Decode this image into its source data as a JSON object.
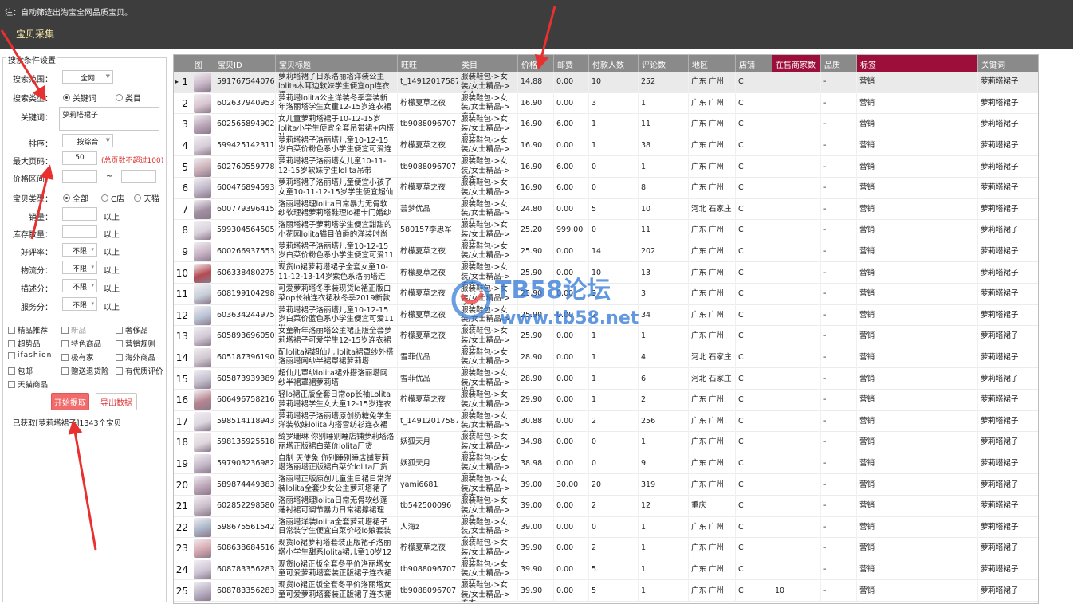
{
  "header": {
    "note": "注：自动筛选出淘宝全网品质宝贝。",
    "title": "宝贝采集"
  },
  "search": {
    "legend": "搜索条件设置",
    "range_label": "搜索范围：",
    "range_value": "全网",
    "type_label": "搜索类型：",
    "type_keyword": "关键词",
    "type_category": "类目",
    "keyword_label": "关键词：",
    "keyword_value": "萝莉塔裙子",
    "sort_label": "排序：",
    "sort_value": "按综合",
    "maxpage_label": "最大页码：",
    "maxpage_value": "50",
    "maxpage_hint": "(总页数不超过100)",
    "price_label": "价格区间：",
    "price_sep": "~",
    "shoptype_label": "宝贝类型：",
    "shoptype_all": "全部",
    "shoptype_c": "C店",
    "shoptype_tmall": "天猫",
    "sales_label": "销量：",
    "stock_label": "库存数量：",
    "unit_above": "以上",
    "good_label": "好评率：",
    "logistics_label": "物流分：",
    "desc_label": "描述分：",
    "service_label": "服务分：",
    "unlimited": "不限"
  },
  "checkboxes": [
    "精品推荐",
    "新品",
    "奢侈品",
    "超势品",
    "特色商品",
    "营销规则",
    "ifashion",
    "极有家",
    "海外商品",
    "包邮",
    "赠送退货险",
    "有优质评价",
    "天猫商品"
  ],
  "buttons": {
    "start": "开始提取",
    "export": "导出数据"
  },
  "status_text": "已获取[萝莉塔裙子]1343个宝贝",
  "watermark": {
    "line1": "TB58论坛",
    "line2": "www.tb58.net"
  },
  "table": {
    "columns": [
      "",
      "图",
      "宝贝ID",
      "宝贝标题",
      "旺旺",
      "类目",
      "价格",
      "邮费",
      "付款人数",
      "评论数",
      "地区",
      "店铺",
      "在售商家数",
      "品质",
      "标签",
      "关键词"
    ],
    "thumb_colors": [
      "#c9b8c8",
      "#d8c4cf",
      "#b9a4b8",
      "#d6ccd8",
      "#cbb0b8",
      "#bfb6c8",
      "#a08fa2",
      "#d9d2dc",
      "#c8b3c6",
      "#b44a52",
      "#c7cfd9",
      "#b9c2d4",
      "#d1c8d5",
      "#cfc7d0",
      "#c4bfcd",
      "#b68590",
      "#dcd6e0",
      "#e0d7dd",
      "#c5b8c8",
      "#bda6b8",
      "#c9bcc9",
      "#a8b4c6",
      "#d7a8b0",
      "#cdc5d6",
      "#b9b0c3"
    ],
    "rows": [
      [
        "1",
        "591767544076",
        "萝莉塔裙子日系洛丽塔洋装公主lolita木耳边软妹学生便宜op连衣裙",
        "t_1491201758798",
        "服装鞋包->女装/女士精品->连衣",
        "14.88",
        "0.00",
        "10",
        "252",
        "广东 广州",
        "C",
        "",
        "-",
        "营销",
        "萝莉塔裙子"
      ],
      [
        "2",
        "602637940953",
        "萝莉塔lolita公主洋装冬季套装新年洛丽塔学生女童12-15岁连衣裙",
        "柠檬夏草之夜",
        "服装鞋包->女装/女士精品->连衣",
        "16.90",
        "0.00",
        "3",
        "1",
        "广东 广州",
        "C",
        "",
        "-",
        "营销",
        "萝莉塔裙子"
      ],
      [
        "3",
        "602565894902",
        "女儿童萝莉塔裙子10-12-15岁lolita小学生便宜全套吊带裙+内搭秋",
        "tb9088096707",
        "服装鞋包->女装/女士精品->连衣",
        "16.90",
        "6.00",
        "1",
        "11",
        "广东 广州",
        "C",
        "",
        "-",
        "营销",
        "萝莉塔裙子"
      ],
      [
        "4",
        "599425142311",
        "萝莉塔裙子洛丽塔儿童10-12-15岁白菜价粉色系小学生便宜可爱连衣",
        "柠檬夏草之夜",
        "服装鞋包->女装/女士精品->连衣",
        "16.90",
        "0.00",
        "1",
        "38",
        "广东 广州",
        "C",
        "",
        "-",
        "营销",
        "萝莉塔裙子"
      ],
      [
        "5",
        "602760559778",
        "萝莉塔裙子洛丽塔女儿童10-11-12-15岁软妹学生lolita吊带",
        "tb9088096707",
        "服装鞋包->女装/女士精品->连衣",
        "16.90",
        "6.00",
        "0",
        "1",
        "广东 广州",
        "C",
        "",
        "-",
        "营销",
        "萝莉塔裙子"
      ],
      [
        "6",
        "600476894593",
        "萝莉塔裙子洛丽塔儿童便宜小孩子女童10-11-12-15岁学生便宜超仙",
        "柠檬夏草之夜",
        "服装鞋包->女装/女士精品->连衣",
        "16.90",
        "6.00",
        "0",
        "8",
        "广东 广州",
        "C",
        "",
        "-",
        "营销",
        "萝莉塔裙子"
      ],
      [
        "7",
        "600779396415",
        "洛丽塔裙理lolita日常暴力无骨软纱软理裙萝莉塔鞋理lo裙卡门婚纱",
        "芸梦优品",
        "服装鞋包->女装/女士精品->半身",
        "24.80",
        "0.00",
        "5",
        "10",
        "河北 石家庄",
        "C",
        "",
        "-",
        "营销",
        "萝莉塔裙子"
      ],
      [
        "8",
        "599304564505",
        "洛丽塔裙子萝莉塔学生便宜甜甜的小花园lolita猫目伯爵的洋装时尚",
        "580157李忠军",
        "服装鞋包->女装/女士精品->连衣",
        "25.20",
        "999.00",
        "0",
        "11",
        "广东 广州",
        "C",
        "",
        "-",
        "营销",
        "萝莉塔裙子"
      ],
      [
        "9",
        "600266937553",
        "萝莉塔裙子洛丽塔儿童10-12-15岁白菜价粉色系小学生便宜可爱11岁",
        "柠檬夏草之夜",
        "服装鞋包->女装/女士精品->连衣",
        "25.90",
        "0.00",
        "14",
        "202",
        "广东 广州",
        "C",
        "",
        "-",
        "营销",
        "萝莉塔裙子"
      ],
      [
        "10",
        "606338480275",
        "现货lo裙萝莉塔裙子全套女童10-11-12-13-14岁紫色系洛丽塔连",
        "柠檬夏草之夜",
        "服装鞋包->女装/女士精品->连衣",
        "25.90",
        "0.00",
        "10",
        "13",
        "广东 广州",
        "C",
        "",
        "-",
        "营销",
        "萝莉塔裙子"
      ],
      [
        "11",
        "608199104298",
        "可爱萝莉塔冬季装现货lo裙正版白菜op长袖连衣裙秋冬季2019新款",
        "柠檬夏草之夜",
        "服装鞋包->女装/女士精品->连衣",
        "25.90",
        "0.00",
        "3",
        "3",
        "广东 广州",
        "C",
        "",
        "-",
        "营销",
        "萝莉塔裙子"
      ],
      [
        "12",
        "603634244975",
        "萝莉塔裙子洛丽塔儿童10-12-15岁白菜价蓝色系小学生便宜可爱11岁",
        "柠檬夏草之夜",
        "服装鞋包->女装/女士精品->连衣",
        "25.90",
        "0.00",
        "2",
        "34",
        "广东 广州",
        "C",
        "",
        "-",
        "营销",
        "萝莉塔裙子"
      ],
      [
        "13",
        "605893696050",
        "女童新年洛丽塔公主裙正版全套萝莉塔裙子可爱学生12-15岁连衣裙",
        "柠檬夏草之夜",
        "服装鞋包->女装/女士精品->连衣",
        "25.90",
        "0.00",
        "1",
        "1",
        "广东 广州",
        "C",
        "",
        "-",
        "营销",
        "萝莉塔裙子"
      ],
      [
        "14",
        "605187396190",
        "配lolita裙超仙儿 lolita裙罩纱外搭洛丽塔网纱半裙罩裙萝莉塔",
        "雪菲优品",
        "服装鞋包->女装/女士精品->半身",
        "28.90",
        "0.00",
        "1",
        "4",
        "河北 石家庄",
        "C",
        "",
        "-",
        "营销",
        "萝莉塔裙子"
      ],
      [
        "15",
        "605873939389",
        "超仙儿罩纱lolita裙外搭洛丽塔网纱半裙罩裙萝莉塔",
        "雪菲优品",
        "服装鞋包->女装/女士精品->半身",
        "28.90",
        "0.00",
        "1",
        "6",
        "河北 石家庄",
        "C",
        "",
        "-",
        "营销",
        "萝莉塔裙子"
      ],
      [
        "16",
        "606496758216",
        "轻lo裙正版全套日常op长袖Lolita萝莉塔裙学生女大童12-15岁连衣裙",
        "柠檬夏草之夜",
        "服装鞋包->女装/女士精品->连衣",
        "29.90",
        "0.00",
        "1",
        "2",
        "广东 广州",
        "C",
        "",
        "-",
        "营销",
        "萝莉塔裙子"
      ],
      [
        "17",
        "598514118943",
        "萝莉塔裙子洛丽塔原创奶糖兔学生洋装软妹lolita内搭雪纺衫连衣裙",
        "t_1491201758798",
        "服装鞋包->女装/女士精品->连衣",
        "30.88",
        "0.00",
        "2",
        "256",
        "广东 广州",
        "C",
        "",
        "-",
        "营销",
        "萝莉塔裙子"
      ],
      [
        "18",
        "598135925518",
        "绮罗珊琳 你别睡别睡店铺萝莉塔洛丽塔正版裙白菜价lolita厂货",
        "妖狐天月",
        "服装鞋包->女装/女士精品->连衣",
        "34.98",
        "0.00",
        "0",
        "1",
        "广东 广州",
        "C",
        "",
        "-",
        "营销",
        "萝莉塔裙子"
      ],
      [
        "19",
        "597903236982",
        "自制 天使兔 你别睡别睡店铺萝莉塔洛丽塔正版裙白菜价lolita厂货",
        "妖狐天月",
        "服装鞋包->女装/女士精品->连衣",
        "38.98",
        "0.00",
        "0",
        "9",
        "广东 广州",
        "C",
        "",
        "-",
        "营销",
        "萝莉塔裙子"
      ],
      [
        "20",
        "589874449383",
        "洛丽塔正版原创儿童生日裙日常洋装lolita全套少女公主萝莉塔裙子",
        "yami6681",
        "服装鞋包->女装/女士精品->连衣",
        "39.00",
        "30.00",
        "20",
        "319",
        "广东 广州",
        "C",
        "",
        "-",
        "营销",
        "萝莉塔裙子"
      ],
      [
        "21",
        "602852298580",
        "洛丽塔裙理lolita日常无骨软纱蓬蓬衬裙可调节暴力日常裙撑裙理",
        "tb542500096",
        "服装鞋包->女装/女士精品->半身",
        "39.00",
        "0.00",
        "2",
        "12",
        "重庆",
        "C",
        "",
        "-",
        "营销",
        "萝莉塔裙子"
      ],
      [
        "22",
        "598675561542",
        "洛丽塔洋装lolita全套萝莉塔裙子日常装学生便宜白菜价轻lo娘套装",
        "人海z",
        "服装鞋包->女装/女士精品->连衣",
        "39.00",
        "0.00",
        "0",
        "1",
        "广东 广州",
        "C",
        "",
        "-",
        "营销",
        "萝莉塔裙子"
      ],
      [
        "23",
        "608638684516",
        "现货lo裙萝莉塔套装正版裙子洛丽塔小学生甜系lolita裙儿童10岁12",
        "柠檬夏草之夜",
        "服装鞋包->女装/女士精品->连衣",
        "39.90",
        "0.00",
        "2",
        "1",
        "广东 广州",
        "C",
        "",
        "-",
        "营销",
        "萝莉塔裙子"
      ],
      [
        "24",
        "608783356283",
        "现货lo裙正版全套冬平价洛丽塔女童可爱萝莉塔套装正版裙子连衣裙",
        "tb9088096707",
        "服装鞋包->女装/女士精品->连衣",
        "39.90",
        "0.00",
        "5",
        "1",
        "广东 广州",
        "C",
        "",
        "-",
        "营销",
        "萝莉塔裙子"
      ],
      [
        "25",
        "608783356283",
        "现货lo裙正版全套冬平价洛丽塔女童可爱萝莉塔套装正版裙子连衣裙",
        "tb9088096707",
        "服装鞋包->女装/女士精品->连衣",
        "39.90",
        "0.00",
        "5",
        "1",
        "广东 广州",
        "C",
        "10",
        "-",
        "营销",
        "萝莉塔裙子"
      ]
    ]
  }
}
